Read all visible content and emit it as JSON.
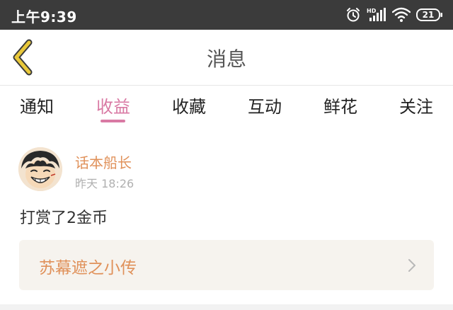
{
  "status_bar": {
    "time": "上午9:39",
    "battery": "21",
    "icons": [
      "alarm-icon",
      "hd-signal-icon",
      "wifi-icon",
      "battery-icon"
    ]
  },
  "nav": {
    "title": "消息",
    "back_icon": "chevron-left-icon",
    "accent_color": "#e9c83a"
  },
  "tabs": [
    {
      "label": "通知",
      "active": false
    },
    {
      "label": "收益",
      "active": true
    },
    {
      "label": "收藏",
      "active": false
    },
    {
      "label": "互动",
      "active": false
    },
    {
      "label": "鲜花",
      "active": false
    },
    {
      "label": "关注",
      "active": false
    }
  ],
  "active_tab_color": "#d97aa4",
  "message": {
    "sender": "话本船长",
    "time": "昨天 18:26",
    "text": "打赏了2金币",
    "book_title": "苏幕遮之小传",
    "name_color": "#e0915a"
  }
}
